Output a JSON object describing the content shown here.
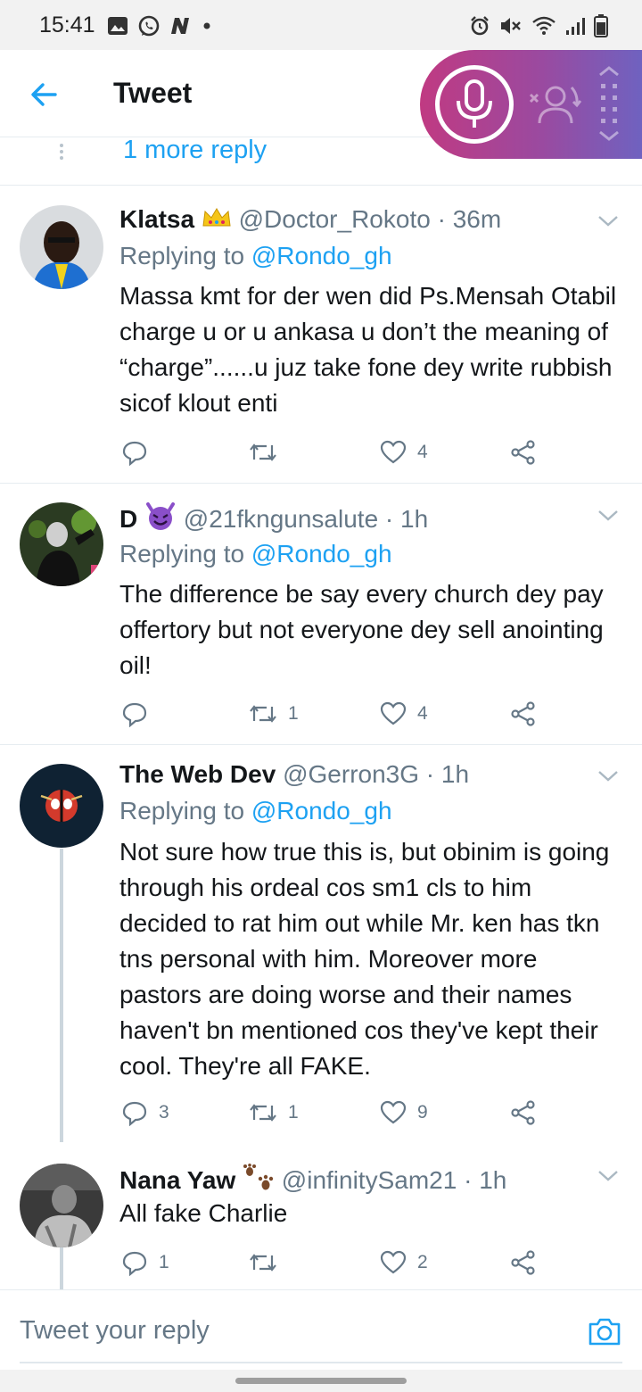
{
  "status_bar": {
    "time": "15:41",
    "left_icons": [
      "gallery-icon",
      "whatsapp-icon",
      "n-app-icon",
      "dot-icon"
    ],
    "right_icons": [
      "alarm-icon",
      "mute-icon",
      "wifi-icon",
      "signal-icon",
      "battery-icon"
    ]
  },
  "header": {
    "title": "Tweet",
    "back_icon": "arrow-left-icon"
  },
  "voice_widget": {
    "icons": [
      "microphone-icon",
      "user-remove-icon",
      "drag-handle-icon"
    ]
  },
  "more_replies": {
    "label": "1 more reply"
  },
  "tweets": [
    {
      "name": "Klatsa",
      "name_emoji": "crown",
      "handle": "@Doctor_Rokoto",
      "time": "36m",
      "replying_prefix": "Replying to ",
      "replying_to": "@Rondo_gh",
      "text": "Massa kmt for der wen did Ps.Mensah Otabil charge u or u ankasa u don’t the meaning of “charge”......u juz take fone dey write rubbish sicof klout enti",
      "replies": "",
      "retweets": "",
      "likes": "4"
    },
    {
      "name": "D",
      "name_emoji": "smiling-devil",
      "handle": "@21fkngunsalute",
      "time": "1h",
      "replying_prefix": "Replying to ",
      "replying_to": "@Rondo_gh",
      "text": "The difference be say every church dey pay offertory but not everyone dey sell anointing oil!",
      "replies": "",
      "retweets": "1",
      "likes": "4"
    },
    {
      "name": "The Web Dev",
      "name_emoji": "",
      "handle": "@Gerron3G",
      "time": "1h",
      "replying_prefix": "Replying to ",
      "replying_to": "@Rondo_gh",
      "text": "Not sure how true this is, but obinim is going through his ordeal cos sm1 cls to him decided to rat him out while Mr. ken has tkn tns personal with him. Moreover more pastors are doing worse and their names haven't bn mentioned cos they've kept their cool. They're all FAKE.",
      "replies": "3",
      "retweets": "1",
      "likes": "9"
    },
    {
      "name": "Nana Yaw",
      "name_emoji": "paw-prints",
      "handle": "@infinitySam21",
      "time": "1h",
      "text": "All fake Charlie",
      "replies": "1",
      "retweets": "",
      "likes": "2"
    }
  ],
  "time_separator": " · ",
  "reply_bar": {
    "placeholder": "Tweet your reply",
    "camera_icon": "camera-icon"
  },
  "colors": {
    "accent": "#1da1f2",
    "text_primary": "#14171a",
    "text_secondary": "#657786",
    "divider": "#e6ecf0",
    "widget_gradient_start": "#c03a82",
    "widget_gradient_end": "#6f62c0"
  }
}
